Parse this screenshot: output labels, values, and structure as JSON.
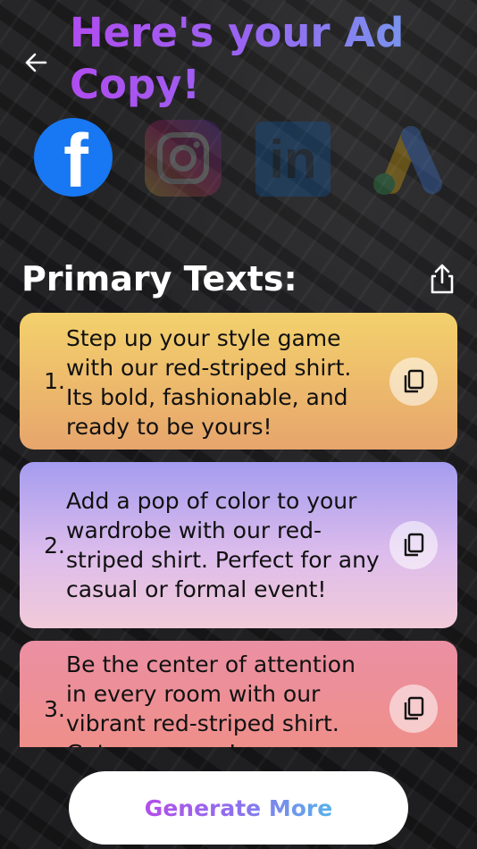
{
  "header": {
    "title": "Here's your Ad Copy!",
    "back_icon": "arrow-left-icon"
  },
  "platforms": [
    {
      "name": "facebook",
      "glyph": "f",
      "selected": true,
      "color": "#1877f2"
    },
    {
      "name": "instagram",
      "selected": false
    },
    {
      "name": "linkedin",
      "glyph": "in",
      "selected": false,
      "color": "#0a66c2"
    },
    {
      "name": "google-ads",
      "selected": false
    }
  ],
  "section": {
    "title": "Primary Texts:",
    "share_icon": "share-icon"
  },
  "primary_texts": [
    {
      "number": "1.",
      "text": "Step up your style game with our red-striped shirt. Its bold, fashionable, and ready to be yours!"
    },
    {
      "number": "2.",
      "text": "Add a pop of color to your wardrobe with our red-striped shirt. Perfect for any casual or formal event!"
    },
    {
      "number": "3.",
      "text": "Be the center of attention in every room with our vibrant red-striped shirt. Get yours now!"
    }
  ],
  "footer": {
    "generate_label": "Generate More"
  },
  "colors": {
    "title_gradient": [
      "#b14cf0",
      "#6fa2ec"
    ],
    "card_1": "#f3d16c",
    "card_2": "#a59cef",
    "card_3": "#eb8fa3"
  }
}
